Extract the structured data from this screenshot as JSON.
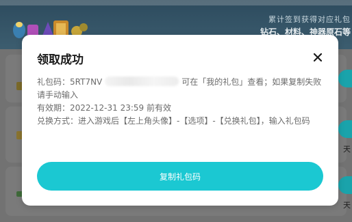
{
  "background": {
    "header_line1": "累计签到获得对应礼包",
    "header_line2": "钻石、材料、神器原石等",
    "side_text_1": "天",
    "side_text_2": "天"
  },
  "modal": {
    "title": "领取成功",
    "close_icon": "close-icon",
    "code_label": "礼包码：",
    "code_value": "5RT7NV",
    "code_suffix": "可在「我的礼包」查看；如果复制失败请手动输入",
    "validity_label": "有效期：",
    "validity_value": "2022-12-31 23:59 前有效",
    "redeem_label": "兑换方式：",
    "redeem_value": "进入游戏后【左上角头像】-【选项】-【兑换礼包】，输入礼包码",
    "copy_button_label": "复制礼包码"
  },
  "colors": {
    "accent": "#1bc8d2",
    "title_text": "#1a1a1a",
    "body_text": "#6b6b6b",
    "overlay": "#6f6f6f"
  }
}
